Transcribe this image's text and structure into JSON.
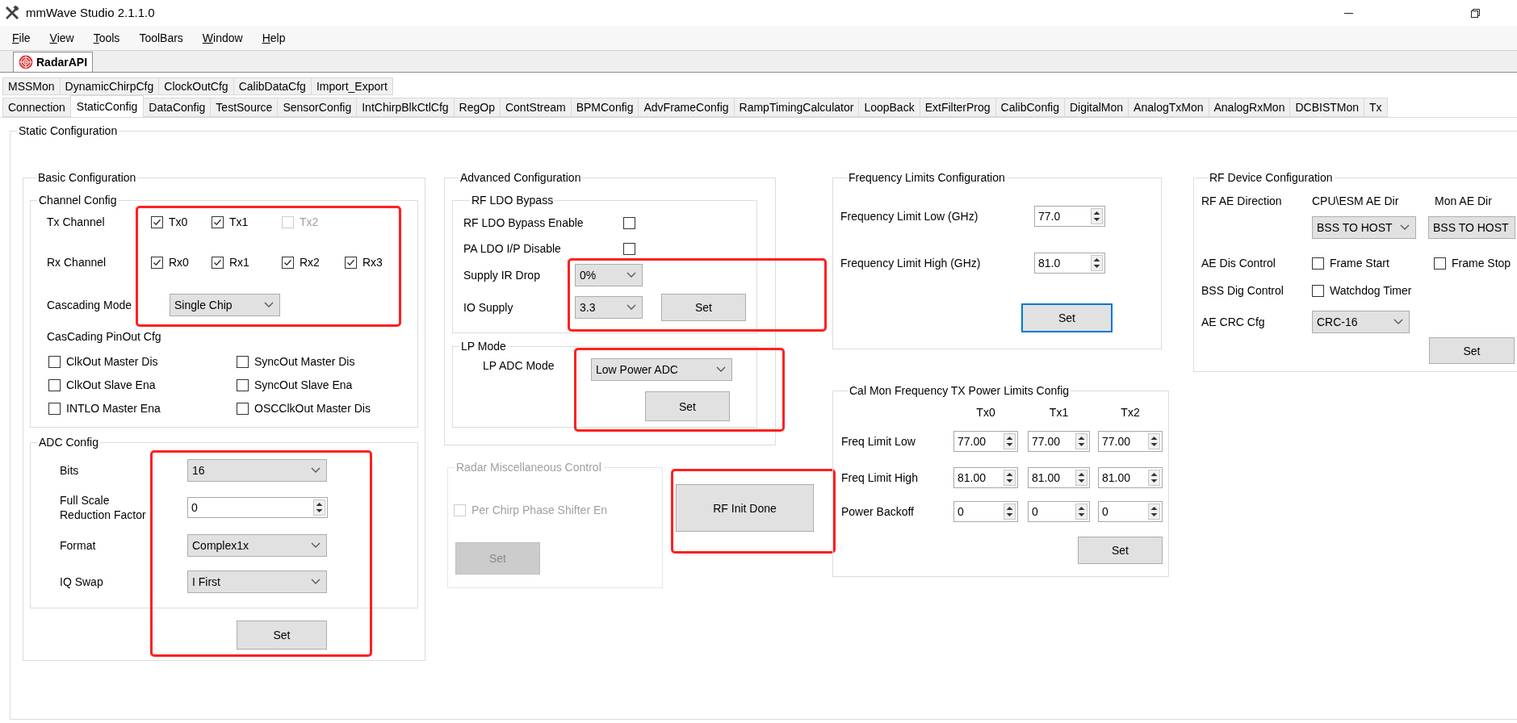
{
  "window": {
    "title": "mmWave Studio 2.1.1.0"
  },
  "menu": [
    {
      "label": "File",
      "access_key": true
    },
    {
      "label": "View",
      "access_key": true
    },
    {
      "label": "Tools",
      "access_key": true
    },
    {
      "label": "ToolBars",
      "access_key": false
    },
    {
      "label": "Window",
      "access_key": true
    },
    {
      "label": "Help",
      "access_key": true
    }
  ],
  "doc_tab": {
    "label": "RadarAPI",
    "selected": true
  },
  "tabs_row1": [
    {
      "label": "MSSMon",
      "selected": false
    },
    {
      "label": "DynamicChirpCfg",
      "selected": false
    },
    {
      "label": "ClockOutCfg",
      "selected": false
    },
    {
      "label": "CalibDataCfg",
      "selected": false
    },
    {
      "label": "Import_Export",
      "selected": false
    }
  ],
  "tabs_row2": [
    {
      "label": "Connection",
      "selected": false
    },
    {
      "label": "StaticConfig",
      "selected": true
    },
    {
      "label": "DataConfig",
      "selected": false
    },
    {
      "label": "TestSource",
      "selected": false
    },
    {
      "label": "SensorConfig",
      "selected": false
    },
    {
      "label": "IntChirpBlkCtlCfg",
      "selected": false
    },
    {
      "label": "RegOp",
      "selected": false
    },
    {
      "label": "ContStream",
      "selected": false
    },
    {
      "label": "BPMConfig",
      "selected": false
    },
    {
      "label": "AdvFrameConfig",
      "selected": false
    },
    {
      "label": "RampTimingCalculator",
      "selected": false
    },
    {
      "label": "LoopBack",
      "selected": false
    },
    {
      "label": "ExtFilterProg",
      "selected": false
    },
    {
      "label": "CalibConfig",
      "selected": false
    },
    {
      "label": "DigitalMon",
      "selected": false
    },
    {
      "label": "AnalogTxMon",
      "selected": false
    },
    {
      "label": "AnalogRxMon",
      "selected": false
    },
    {
      "label": "DCBISTMon",
      "selected": false
    },
    {
      "label": "Tx",
      "selected": false
    }
  ],
  "page_title": "Static Configuration",
  "basic": {
    "title": "Basic Configuration",
    "channel": {
      "title": "Channel Config",
      "highlighted": true,
      "tx_label": "Tx Channel",
      "tx": [
        {
          "label": "Tx0",
          "checked": true,
          "disabled": false
        },
        {
          "label": "Tx1",
          "checked": true,
          "disabled": false
        },
        {
          "label": "Tx2",
          "checked": false,
          "disabled": true
        }
      ],
      "rx_label": "Rx Channel",
      "rx": [
        {
          "label": "Rx0",
          "checked": true,
          "disabled": false
        },
        {
          "label": "Rx1",
          "checked": true,
          "disabled": false
        },
        {
          "label": "Rx2",
          "checked": true,
          "disabled": false
        },
        {
          "label": "Rx3",
          "checked": true,
          "disabled": false
        }
      ],
      "cascading_label": "Cascading Mode",
      "cascading_value": "Single Chip",
      "pinout_label": "CasCading PinOut Cfg",
      "pinout": [
        {
          "label": "ClkOut Master Dis",
          "checked": false
        },
        {
          "label": "SyncOut Master Dis",
          "checked": false
        },
        {
          "label": "ClkOut Slave Ena",
          "checked": false
        },
        {
          "label": "SyncOut Slave Ena",
          "checked": false
        },
        {
          "label": "INTLO Master Ena",
          "checked": false
        },
        {
          "label": "OSCClkOut Master Dis",
          "checked": false
        }
      ]
    },
    "adc": {
      "title": "ADC Config",
      "highlighted": true,
      "fields": [
        {
          "kind": "dropdown",
          "label": "Bits",
          "value": "16"
        },
        {
          "kind": "spin",
          "label": "Full Scale Reduction Factor",
          "value": "0"
        },
        {
          "kind": "dropdown",
          "label": "Format",
          "value": "Complex1x"
        },
        {
          "kind": "dropdown",
          "label": "IQ Swap",
          "value": "I First"
        }
      ],
      "set_button": "Set"
    }
  },
  "advanced": {
    "title": "Advanced Configuration",
    "ldo": {
      "title": "RF LDO Bypass",
      "highlighted": true,
      "rows": [
        {
          "kind": "checkbox",
          "label": "RF LDO Bypass Enable",
          "checked": false
        },
        {
          "kind": "checkbox",
          "label": "PA LDO I/P Disable",
          "checked": false
        },
        {
          "kind": "dropdown",
          "label": "Supply IR Drop",
          "value": "0%"
        },
        {
          "kind": "dropdown",
          "label": "IO Supply",
          "value": "3.3"
        }
      ],
      "set_button": "Set"
    },
    "lp": {
      "title": "LP Mode",
      "highlighted": true,
      "label": "LP ADC Mode",
      "value": "Low Power ADC",
      "set_button": "Set"
    }
  },
  "misc": {
    "title": "Radar Miscellaneous Control",
    "disabled": true,
    "checkbox": {
      "label": "Per Chirp Phase Shifter En",
      "checked": false
    },
    "set_button": "Set"
  },
  "rf_init": {
    "label": "RF Init Done",
    "highlighted": true
  },
  "freq": {
    "title": "Frequency Limits Configuration",
    "rows": [
      {
        "label": "Frequency Limit Low (GHz)",
        "value": "77.0"
      },
      {
        "label": "Frequency Limit High (GHz)",
        "value": "81.0"
      }
    ],
    "set_button": "Set",
    "set_focused": true
  },
  "calmon": {
    "title": "Cal Mon Frequency TX Power Limits Config",
    "columns": [
      "Tx0",
      "Tx1",
      "Tx2"
    ],
    "rows": [
      {
        "label": "Freq Limit Low",
        "values": [
          "77.00",
          "77.00",
          "77.00"
        ]
      },
      {
        "label": "Freq Limit High",
        "values": [
          "81.00",
          "81.00",
          "81.00"
        ]
      },
      {
        "label": "Power Backoff",
        "values": [
          "0",
          "0",
          "0"
        ]
      }
    ],
    "set_button": "Set"
  },
  "rfdev": {
    "title": "RF Device Configuration",
    "ae_dir_label": "RF AE Direction",
    "ae_dir": [
      {
        "heading": "CPU\\ESM AE Dir",
        "value": "BSS TO HOST",
        "caret_visible": true
      },
      {
        "heading": "Mon AE Dir",
        "value": "BSS TO HOST",
        "caret_visible": false
      }
    ],
    "ae_dis_label": "AE Dis Control",
    "ae_dis": [
      {
        "label": "Frame Start",
        "checked": false
      },
      {
        "label": "Frame Stop",
        "checked": false
      }
    ],
    "bss_label": "BSS Dig Control",
    "bss": {
      "label": "Watchdog Timer",
      "checked": false
    },
    "crc_label": "AE CRC Cfg",
    "crc_value": "CRC-16",
    "set_button": "Set"
  }
}
